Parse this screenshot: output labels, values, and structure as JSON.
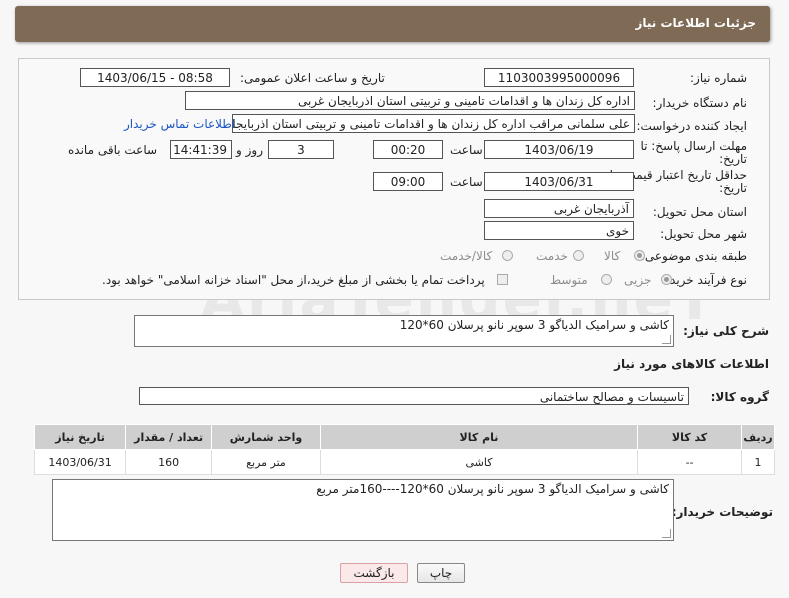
{
  "header": {
    "title": "جزئیات اطلاعات نیاز"
  },
  "fields": {
    "need_number_label": "شماره نیاز:",
    "need_number": "1103003995000096",
    "announce_label": "تاریخ و ساعت اعلان عمومی:",
    "announce_value": "1403/06/15 - 08:58",
    "buyer_label": "نام دستگاه خریدار:",
    "buyer_value": "اداره کل زندان ها و اقدامات تامینی و تربیتی استان اذربایجان غربی",
    "creator_label": "ایجاد کننده درخواست:",
    "creator_value": "علی سلمانی مراقب اداره کل زندان ها و اقدامات تامینی و تربیتی استان اذربایجا",
    "contact_link": "اطلاعات تماس خریدار",
    "deadline_label": "مهلت ارسال پاسخ: تا",
    "deadline_label2": "تاریخ:",
    "deadline_date": "1403/06/19",
    "time_label": "ساعت",
    "deadline_time": "00:20",
    "days_value": "3",
    "days_label": "روز و",
    "remaining_time": "14:41:39",
    "remaining_label": "ساعت باقی مانده",
    "validity_label": "حداقل تاریخ اعتبار قیمت: تا",
    "validity_label2": "تاریخ:",
    "validity_date": "1403/06/31",
    "validity_time": "09:00",
    "province_label": "استان محل تحویل:",
    "province_value": "آذربایجان غربی",
    "city_label": "شهر محل تحویل:",
    "city_value": "خوی",
    "category_label": "طبقه بندی موضوعی:",
    "category_options": [
      "کالا",
      "خدمت",
      "کالا/خدمت"
    ],
    "process_label": "نوع فرآیند خرید :",
    "process_options": [
      "جزیی",
      "متوسط"
    ],
    "payment_note": "پرداخت تمام یا بخشی از مبلغ خرید،از محل \"اسناد خزانه اسلامی\" خواهد بود."
  },
  "summary": {
    "label": "شرح کلی نیاز:",
    "value": "کاشی و سرامیک الدیاگو 3 سوپر نانو پرسلان 60*120"
  },
  "goods_info_title": "اطلاعات کالاهای مورد نیاز",
  "goods_group": {
    "label": "گروه کالا:",
    "value": "تاسیسات و مصالح ساختمانی"
  },
  "table": {
    "headers": [
      "ردیف",
      "کد کالا",
      "نام کالا",
      "واحد شمارش",
      "تعداد / مقدار",
      "تاریخ نیاز"
    ],
    "rows": [
      [
        "1",
        "--",
        "کاشی",
        "متر مربع",
        "160",
        "1403/06/31"
      ]
    ]
  },
  "buyer_notes": {
    "label": "توضیحات خریدار:",
    "value": "کاشی و سرامیک الدیاگو 3 سوپر نانو پرسلان 60*120----160متر مربع"
  },
  "buttons": {
    "print": "چاپ",
    "back": "بازگشت"
  },
  "watermark": "AriaTender.neT"
}
